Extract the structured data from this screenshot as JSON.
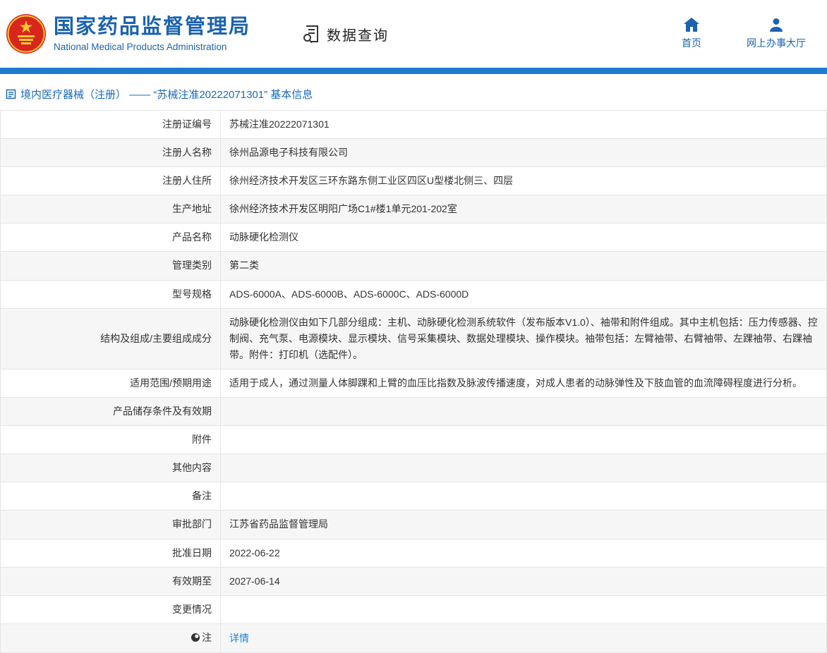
{
  "header": {
    "org_name_cn": "国家药品监督管理局",
    "org_name_en": "National Medical Products Administration",
    "section_title": "数据查询",
    "nav": [
      {
        "label": "首页"
      },
      {
        "label": "网上办事大厅"
      }
    ]
  },
  "colors": {
    "brand_blue": "#1c63ae",
    "bar_blue": "#1e7ace",
    "link_blue": "#1e80d0",
    "stripe": "#f6f6f6"
  },
  "breadcrumb": {
    "text": "境内医疗器械（注册） —— “苏械注准20222071301” 基本信息"
  },
  "table": {
    "rows": [
      {
        "label": "注册证编号",
        "value": "苏械注准20222071301"
      },
      {
        "label": "注册人名称",
        "value": "徐州品源电子科技有限公司"
      },
      {
        "label": "注册人住所",
        "value": "徐州经济技术开发区三环东路东侧工业区四区U型楼北侧三、四层"
      },
      {
        "label": "生产地址",
        "value": "徐州经济技术开发区明阳广场C1#楼1单元201-202室"
      },
      {
        "label": "产品名称",
        "value": "动脉硬化检测仪"
      },
      {
        "label": "管理类别",
        "value": "第二类"
      },
      {
        "label": "型号规格",
        "value": "ADS-6000A、ADS-6000B、ADS-6000C、ADS-6000D"
      },
      {
        "label": "结构及组成/主要组成成分",
        "value": "动脉硬化检测仪由如下几部分组成：主机、动脉硬化检测系统软件（发布版本V1.0）、袖带和附件组成。其中主机包括：压力传感器、控制阀、充气泵、电源模块、显示模块、信号采集模块、数据处理模块、操作模块。袖带包括：左臂袖带、右臂袖带、左踝袖带、右踝袖带。附件：打印机（选配件）。"
      },
      {
        "label": "适用范围/预期用途",
        "value": "适用于成人，通过测量人体脚踝和上臂的血压比指数及脉波传播速度，对成人患者的动脉弹性及下肢血管的血流障碍程度进行分析。"
      },
      {
        "label": "产品储存条件及有效期",
        "value": ""
      },
      {
        "label": "附件",
        "value": ""
      },
      {
        "label": "其他内容",
        "value": ""
      },
      {
        "label": "备注",
        "value": ""
      },
      {
        "label": "审批部门",
        "value": "江苏省药品监督管理局"
      },
      {
        "label": "批准日期",
        "value": "2022-06-22"
      },
      {
        "label": "有效期至",
        "value": "2027-06-14"
      },
      {
        "label": "变更情况",
        "value": ""
      }
    ],
    "note_row": {
      "label": "注",
      "link_label": "详情"
    }
  }
}
